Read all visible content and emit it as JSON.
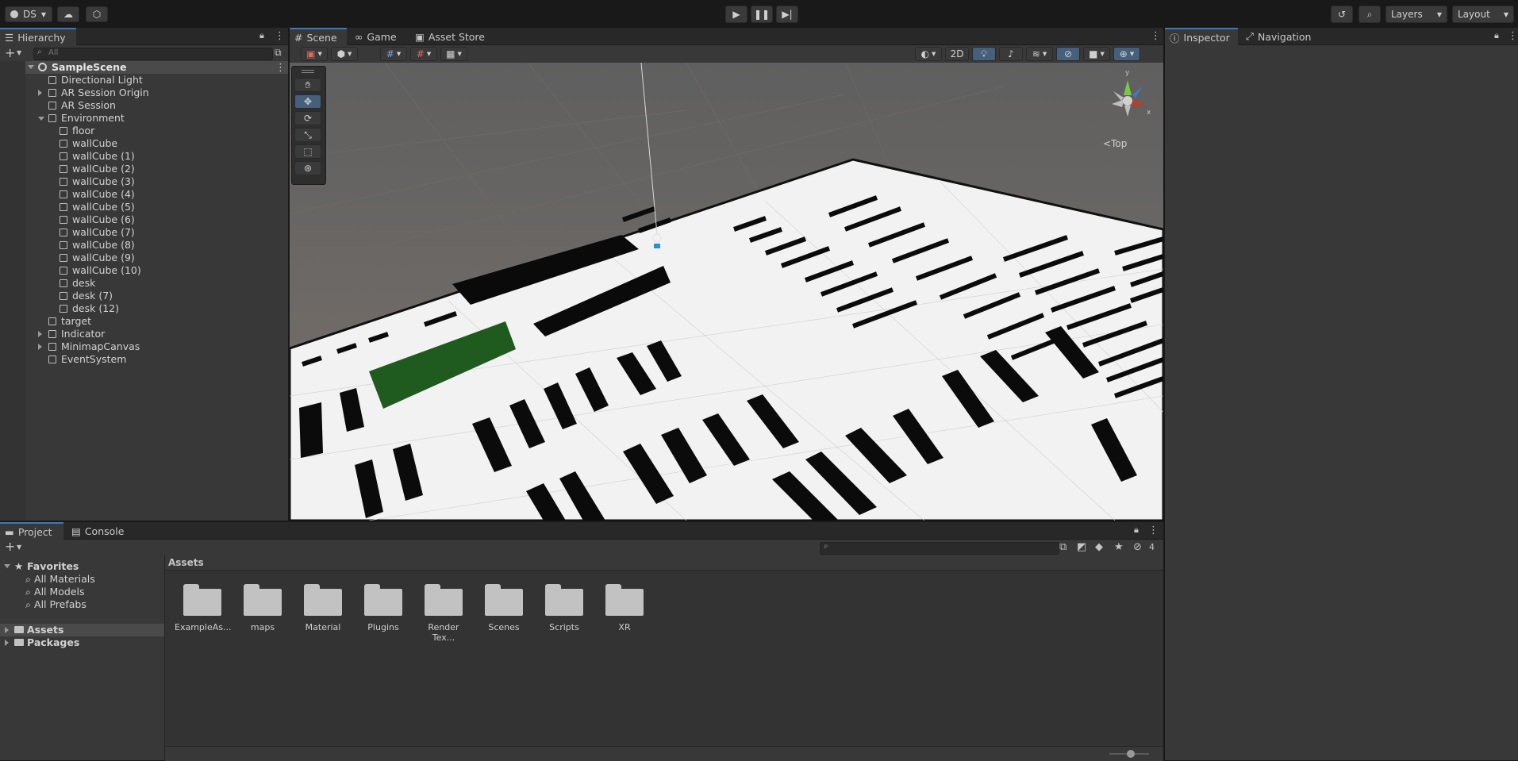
{
  "top_toolbar": {
    "account": "DS",
    "layers": "Layers",
    "layout": "Layout"
  },
  "hierarchy": {
    "tab": "Hierarchy",
    "search_placeholder": "All",
    "scene": "SampleScene",
    "items": [
      {
        "label": "Directional Light"
      },
      {
        "label": "AR Session Origin"
      },
      {
        "label": "AR Session"
      },
      {
        "label": "Environment"
      },
      {
        "label": "floor"
      },
      {
        "label": "wallCube"
      },
      {
        "label": "wallCube (1)"
      },
      {
        "label": "wallCube (2)"
      },
      {
        "label": "wallCube (3)"
      },
      {
        "label": "wallCube (4)"
      },
      {
        "label": "wallCube (5)"
      },
      {
        "label": "wallCube (6)"
      },
      {
        "label": "wallCube (7)"
      },
      {
        "label": "wallCube (8)"
      },
      {
        "label": "wallCube (9)"
      },
      {
        "label": "wallCube (10)"
      },
      {
        "label": "desk"
      },
      {
        "label": "desk (7)"
      },
      {
        "label": "desk (12)"
      },
      {
        "label": "target"
      },
      {
        "label": "Indicator"
      },
      {
        "label": "MinimapCanvas"
      },
      {
        "label": "EventSystem"
      }
    ]
  },
  "scene_view": {
    "tabs": [
      "Scene",
      "Game",
      "Asset Store"
    ],
    "mode_2d": "2D",
    "gizmo_view": "Top",
    "gizmo_axes": [
      "y",
      "x"
    ]
  },
  "inspector": {
    "tabs": [
      "Inspector",
      "Navigation"
    ]
  },
  "project": {
    "tabs": [
      "Project",
      "Console"
    ],
    "favorites": "Favorites",
    "favorite_items": [
      "All Materials",
      "All Models",
      "All Prefabs"
    ],
    "roots": [
      "Assets",
      "Packages"
    ],
    "breadcrumb": "Assets",
    "hidden_count": "4",
    "folders": [
      "ExampleAs...",
      "maps",
      "Material",
      "Plugins",
      "Render Tex...",
      "Scenes",
      "Scripts",
      "XR"
    ]
  }
}
